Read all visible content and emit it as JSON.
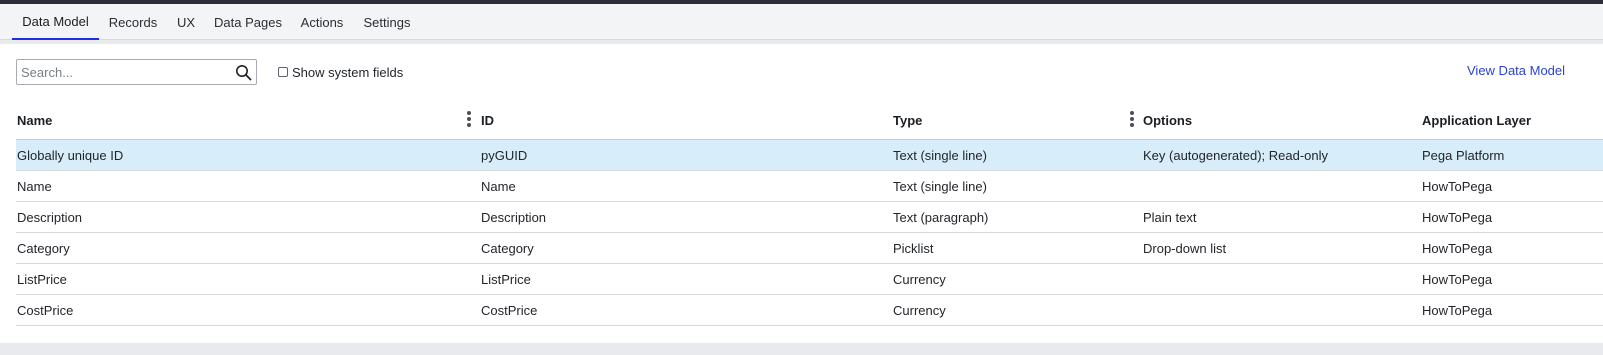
{
  "tabs": [
    {
      "label": "Data Model",
      "active": true
    },
    {
      "label": "Records",
      "active": false
    },
    {
      "label": "UX",
      "active": false
    },
    {
      "label": "Data Pages",
      "active": false
    },
    {
      "label": "Actions",
      "active": false
    },
    {
      "label": "Settings",
      "active": false
    }
  ],
  "toolbar": {
    "search_placeholder": "Search...",
    "search_value": "",
    "search_icon": "search-icon",
    "show_system_fields_label": "Show system fields",
    "show_system_fields_checked": false,
    "view_data_model_label": "View Data Model"
  },
  "table": {
    "columns": [
      "Name",
      "ID",
      "Type",
      "Options",
      "Application Layer"
    ],
    "rows": [
      {
        "name": "Globally unique ID",
        "id": "pyGUID",
        "type": "Text (single line)",
        "options": "Key (autogenerated); Read-only",
        "layer": "Pega Platform",
        "selected": true
      },
      {
        "name": "Name",
        "id": "Name",
        "type": "Text (single line)",
        "options": "",
        "layer": "HowToPega",
        "selected": false
      },
      {
        "name": "Description",
        "id": "Description",
        "type": "Text (paragraph)",
        "options": "Plain text",
        "layer": "HowToPega",
        "selected": false
      },
      {
        "name": "Category",
        "id": "Category",
        "type": "Picklist",
        "options": "Drop-down list",
        "layer": "HowToPega",
        "selected": false
      },
      {
        "name": "ListPrice",
        "id": "ListPrice",
        "type": "Currency",
        "options": "",
        "layer": "HowToPega",
        "selected": false
      },
      {
        "name": "CostPrice",
        "id": "CostPrice",
        "type": "Currency",
        "options": "",
        "layer": "HowToPega",
        "selected": false
      }
    ]
  },
  "colors": {
    "accent": "#1f2ee0",
    "link": "#2a44d6",
    "selected_row": "#d7eefa",
    "top_bar": "#2b2e38"
  }
}
